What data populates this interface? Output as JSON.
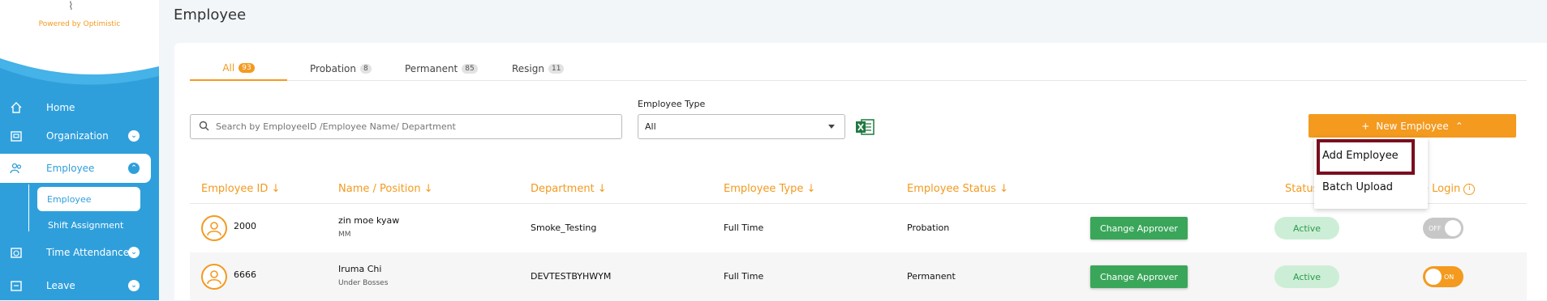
{
  "sidebar": {
    "powered_by": "Powered by Optimistic",
    "items": [
      {
        "label": "Home",
        "icon": "home-icon"
      },
      {
        "label": "Organization",
        "icon": "organization-icon"
      },
      {
        "label": "Employee",
        "icon": "employee-icon"
      },
      {
        "label": "Time Attendance",
        "icon": "clock-icon"
      },
      {
        "label": "Leave",
        "icon": "leave-icon"
      }
    ],
    "employee_sub": [
      "Employee",
      "Shift Assignment"
    ]
  },
  "page": {
    "title": "Employee"
  },
  "tabs": [
    {
      "label": "All",
      "count": "93"
    },
    {
      "label": "Probation",
      "count": "8"
    },
    {
      "label": "Permanent",
      "count": "85"
    },
    {
      "label": "Resign",
      "count": "11"
    }
  ],
  "search": {
    "placeholder": "Search by EmployeeID /Employee Name/ Department"
  },
  "employee_type": {
    "label": "Employee Type",
    "selected": "All"
  },
  "new_employee": {
    "label": "New Employee",
    "menu": [
      "Add Employee",
      "Batch Upload"
    ]
  },
  "table": {
    "headers": [
      "Employee ID",
      "Name / Position",
      "Department",
      "Employee Type",
      "Employee Status",
      "Status",
      "e Login"
    ],
    "rows": [
      {
        "id": "2000",
        "name": "zin moe kyaw",
        "position": "MM",
        "department": "Smoke_Testing",
        "type": "Full Time",
        "emp_status": "Probation",
        "approver": "Change Approver",
        "status": "Active",
        "toggle": "OFF"
      },
      {
        "id": "6666",
        "name": "Iruma Chi",
        "position": "Under Bosses",
        "department": "DEVTESTBYHWYM",
        "type": "Full Time",
        "emp_status": "Permanent",
        "approver": "Change Approver",
        "status": "Active",
        "toggle": "ON"
      }
    ]
  },
  "colors": {
    "accent": "#f39a1f",
    "sidebar": "#2f9fdc",
    "green": "#3aa65a",
    "highlight": "#7a0d1e"
  }
}
